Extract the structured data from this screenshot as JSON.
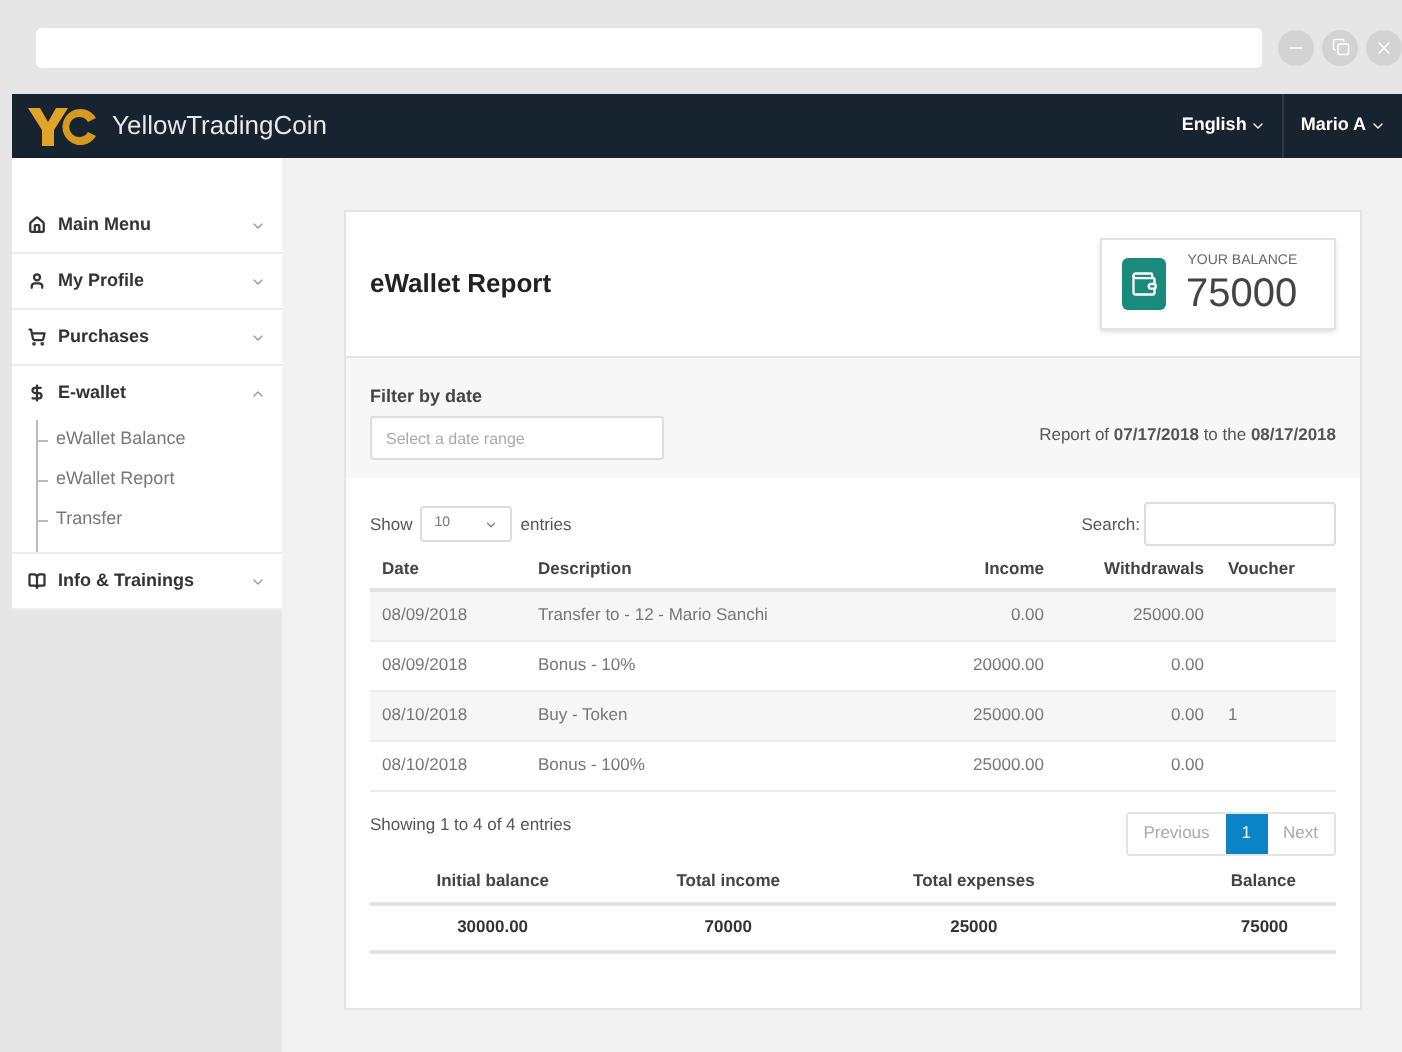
{
  "navbar": {
    "brand": "YellowTradingCoin",
    "language": "English",
    "user": "Mario A"
  },
  "sidebar": {
    "items": [
      {
        "kind": "home",
        "label": "Main Menu",
        "expanded": false
      },
      {
        "kind": "user",
        "label": "My Profile",
        "expanded": false
      },
      {
        "kind": "cart",
        "label": "Purchases",
        "expanded": false
      },
      {
        "kind": "dollar",
        "label": "E-wallet",
        "expanded": true,
        "children": [
          {
            "label": "eWallet Balance"
          },
          {
            "label": "eWallet Report"
          },
          {
            "label": "Transfer"
          }
        ]
      },
      {
        "kind": "book",
        "label": "Info & Trainings",
        "expanded": false
      }
    ]
  },
  "report": {
    "title": "eWallet Report",
    "balance_label": "YOUR BALANCE",
    "balance": "75000",
    "filter_label": "Filter by date",
    "filter_placeholder": "Select a date range",
    "range_text": "Report of **07/17/2018** to the **08/17/2018**",
    "show_label": "Show",
    "page_size": "10",
    "entries_label": "entries",
    "search_label": "Search:",
    "table": {
      "columns": [
        "Date",
        "Description",
        "Income",
        "Withdrawals",
        "Voucher"
      ],
      "rows": [
        [
          "08/09/2018",
          "Transfer to - 12 - Mario Sanchi",
          "0.00",
          "25000.00",
          ""
        ],
        [
          "08/09/2018",
          "Bonus - 10%",
          "20000.00",
          "0.00",
          ""
        ],
        [
          "08/10/2018",
          "Buy - Token",
          "25000.00",
          "0.00",
          "1"
        ],
        [
          "08/10/2018",
          "Bonus - 100%",
          "25000.00",
          "0.00",
          ""
        ]
      ]
    },
    "info": "Showing 1 to 4 of 4 entries",
    "pagination": [
      {
        "label": "Previous",
        "selected": false
      },
      {
        "label": "1",
        "selected": true
      },
      {
        "label": "Next",
        "selected": false
      }
    ],
    "summary": {
      "columns": [
        "Initial balance",
        "Total income",
        "Total expenses",
        "Balance"
      ],
      "values": [
        "30000.00",
        "70000",
        "25000",
        "75000"
      ]
    }
  }
}
